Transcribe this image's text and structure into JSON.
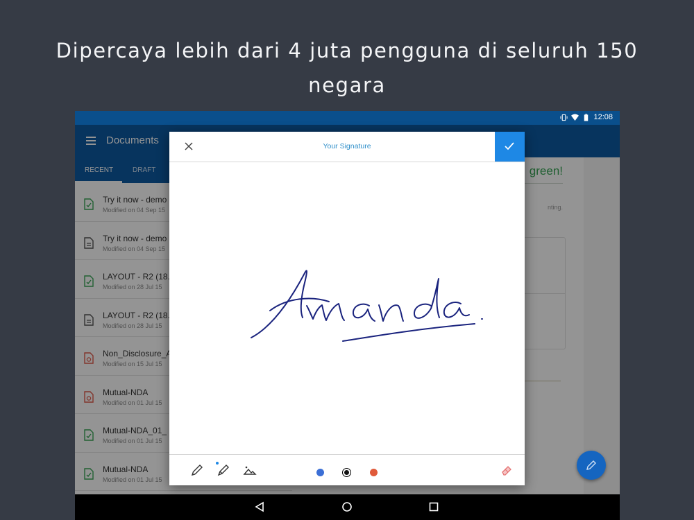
{
  "headline": {
    "line1": "Dipercaya lebih dari 4 juta pengguna di seluruh 150",
    "line2": "negara"
  },
  "statusbar": {
    "time": "12:08",
    "icons": [
      "vibrate-icon",
      "wifi-icon",
      "battery-icon"
    ]
  },
  "appbar": {
    "title": "Documents",
    "menu_icon": "menu-icon"
  },
  "tabs": [
    {
      "label": "RECENT",
      "active": true
    },
    {
      "label": "DRAFT",
      "active": false
    }
  ],
  "documents": [
    {
      "title": "Try it now - demo",
      "date": "Modified on 04 Sep 15",
      "icon": "doc-signed-icon",
      "color": "#3aa657"
    },
    {
      "title": "Try it now - demo",
      "date": "Modified on 04 Sep 15",
      "icon": "doc-icon",
      "color": "#555555"
    },
    {
      "title": "LAYOUT - R2 (18.",
      "date": "Modified on 28 Jul 15",
      "icon": "doc-signed-icon",
      "color": "#3aa657"
    },
    {
      "title": "LAYOUT - R2 (18.",
      "date": "Modified on 28 Jul 15",
      "icon": "doc-icon",
      "color": "#555555"
    },
    {
      "title": "Non_Disclosure_A",
      "date": "Modified on 15 Jul 15",
      "icon": "doc-declined-icon",
      "color": "#e05a4a"
    },
    {
      "title": "Mutual-NDA",
      "date": "Modified on 01 Jul 15",
      "icon": "doc-declined-icon",
      "color": "#e05a4a"
    },
    {
      "title": "Mutual-NDA_01_",
      "date": "Modified on 01 Jul 15",
      "icon": "doc-signed-icon",
      "color": "#3aa657"
    },
    {
      "title": "Mutual-NDA",
      "date": "Modified on 01 Jul 15",
      "icon": "doc-signed-icon",
      "color": "#3aa657"
    }
  ],
  "background_pane": {
    "green_text": "green!",
    "small_text": "nting."
  },
  "dialog": {
    "title": "Your Signature",
    "signature_text": "Amanda",
    "ink_color": "#1a237e",
    "tools": [
      "pen-icon",
      "marker-icon",
      "image-icon"
    ],
    "colors": [
      {
        "name": "blue",
        "hex": "#3b6fd6",
        "selected": false
      },
      {
        "name": "black",
        "hex": "#111111",
        "selected": true
      },
      {
        "name": "red",
        "hex": "#e05a3a",
        "selected": false
      }
    ],
    "eraser_icon": "eraser-icon"
  },
  "navbar": {
    "buttons": [
      "back-icon",
      "home-icon",
      "recents-icon"
    ]
  },
  "accent": "#1e88e5"
}
